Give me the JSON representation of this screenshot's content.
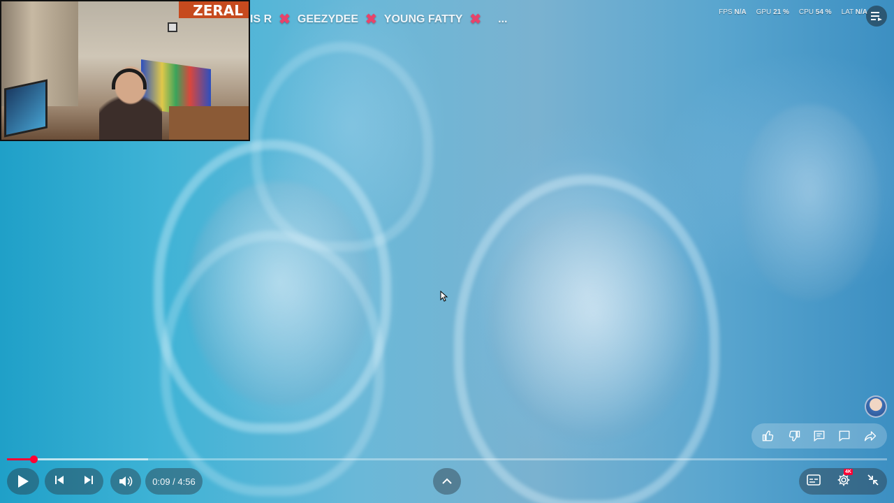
{
  "webcam": {
    "logo_text": "ZERAL"
  },
  "ticker": {
    "items": [
      "IS R",
      "GEEZYDEE",
      "YOUNG FATTY"
    ],
    "more": "..."
  },
  "stats": {
    "fps_label": "FPS",
    "fps_value": "N/A",
    "gpu_label": "GPU",
    "gpu_value": "21 %",
    "cpu_label": "CPU",
    "cpu_value": "54 %",
    "lat_label": "LAT",
    "lat_value": "N/A"
  },
  "player": {
    "time_display": "0:09 / 4:56",
    "played_fraction": 0.0305,
    "buffered_fraction": 0.16,
    "quality_badge": "4K",
    "accent_color": "#ff0033"
  },
  "icons": {
    "play": "play-icon",
    "previous": "previous-icon",
    "next": "next-icon",
    "volume": "volume-icon",
    "expand": "chevron-up-icon",
    "subtitles": "subtitles-icon",
    "settings": "gear-icon",
    "exit_fullscreen": "exit-fullscreen-icon",
    "like": "thumbs-up-icon",
    "dislike": "thumbs-down-icon",
    "comment": "comment-icon",
    "chat": "chat-icon",
    "share": "share-icon",
    "queue": "queue-icon"
  }
}
